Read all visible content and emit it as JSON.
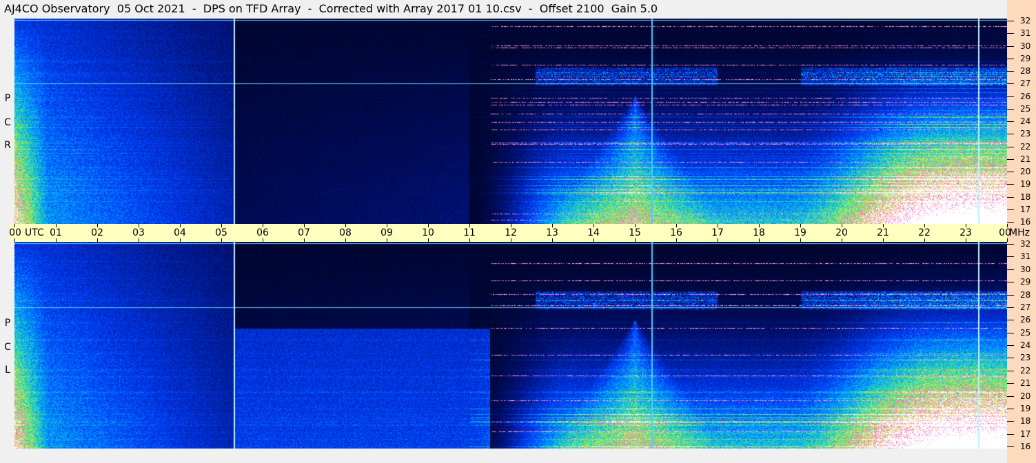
{
  "title": "AJ4CO Observatory  05 Oct 2021  -  DPS on TFD Array  -  Corrected with Array 2017 01 10.csv  -  Offset 2100  Gain 5.0",
  "chart_data": {
    "type": "heatmap",
    "title": "AJ4CO Observatory  05 Oct 2021  -  DPS on TFD Array  -  Corrected with Array 2017 01 10.csv  -  Offset 2100  Gain 5.0",
    "xlabel": "UTC",
    "ylabel": "MHz",
    "xlim": [
      0,
      24
    ],
    "ylim": [
      16,
      32
    ],
    "x_ticks": [
      "00",
      "01",
      "02",
      "03",
      "04",
      "05",
      "06",
      "07",
      "08",
      "09",
      "10",
      "11",
      "12",
      "13",
      "14",
      "15",
      "16",
      "17",
      "18",
      "19",
      "20",
      "21",
      "22",
      "23",
      "00"
    ],
    "y_ticks": [
      16,
      17,
      18,
      19,
      20,
      21,
      22,
      23,
      24,
      25,
      26,
      27,
      28,
      29,
      30,
      31,
      32
    ],
    "panels": [
      {
        "name": "RCP",
        "letters": [
          "R",
          "C",
          "P"
        ]
      },
      {
        "name": "LCP",
        "letters": [
          "L",
          "C",
          "P"
        ]
      }
    ],
    "offset": 2100,
    "gain": 5.0,
    "marker_times_utc": [
      5.3,
      15.4,
      23.3
    ],
    "marker_freq_mhz": 27
  },
  "axis": {
    "utc_label": "UTC",
    "unit_label": "MHz"
  }
}
